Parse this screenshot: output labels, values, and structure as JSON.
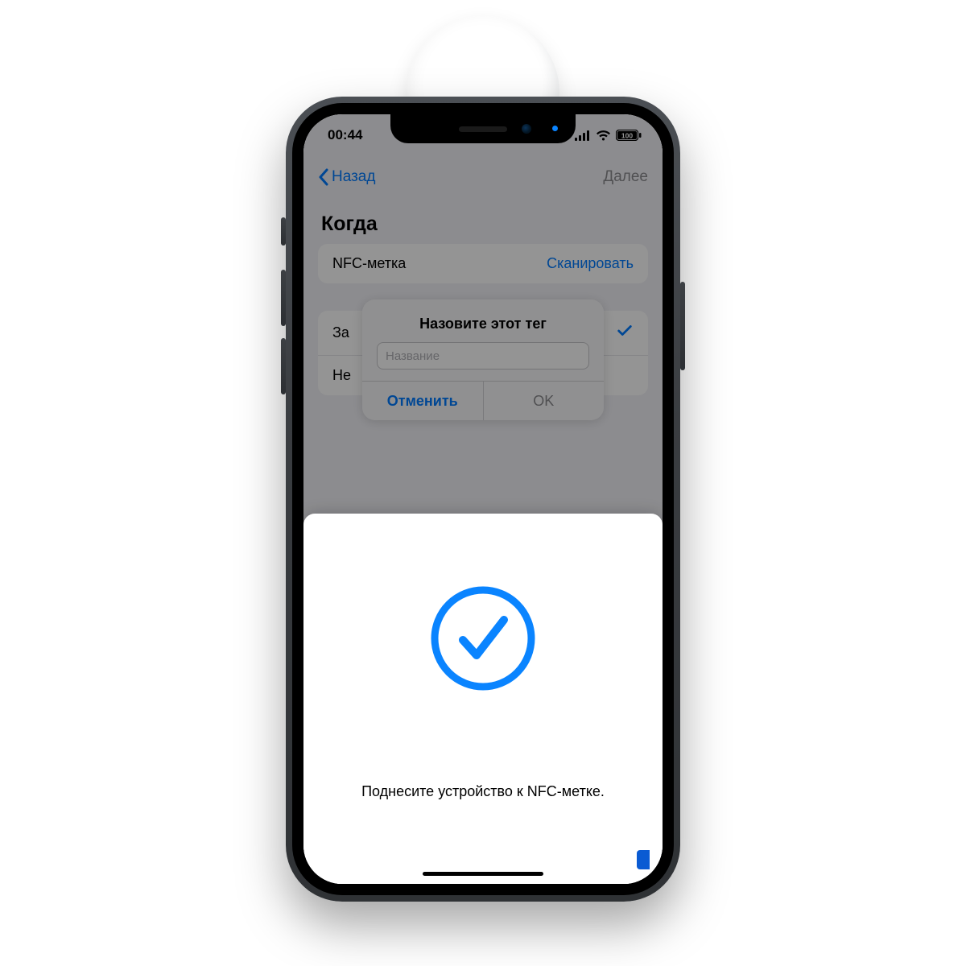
{
  "status": {
    "time": "00:44",
    "battery": "100"
  },
  "nav": {
    "back": "Назад",
    "next": "Далее"
  },
  "section_title": "Когда",
  "group1": {
    "row1_left": "NFC-метка",
    "row1_right": "Сканировать"
  },
  "group2": {
    "row1_left": "За",
    "row2_left": "Не"
  },
  "alert": {
    "title": "Назовите этот тег",
    "placeholder": "Название",
    "cancel": "Отменить",
    "ok": "OK"
  },
  "sheet": {
    "message": "Поднесите устройство к NFC-метке."
  }
}
